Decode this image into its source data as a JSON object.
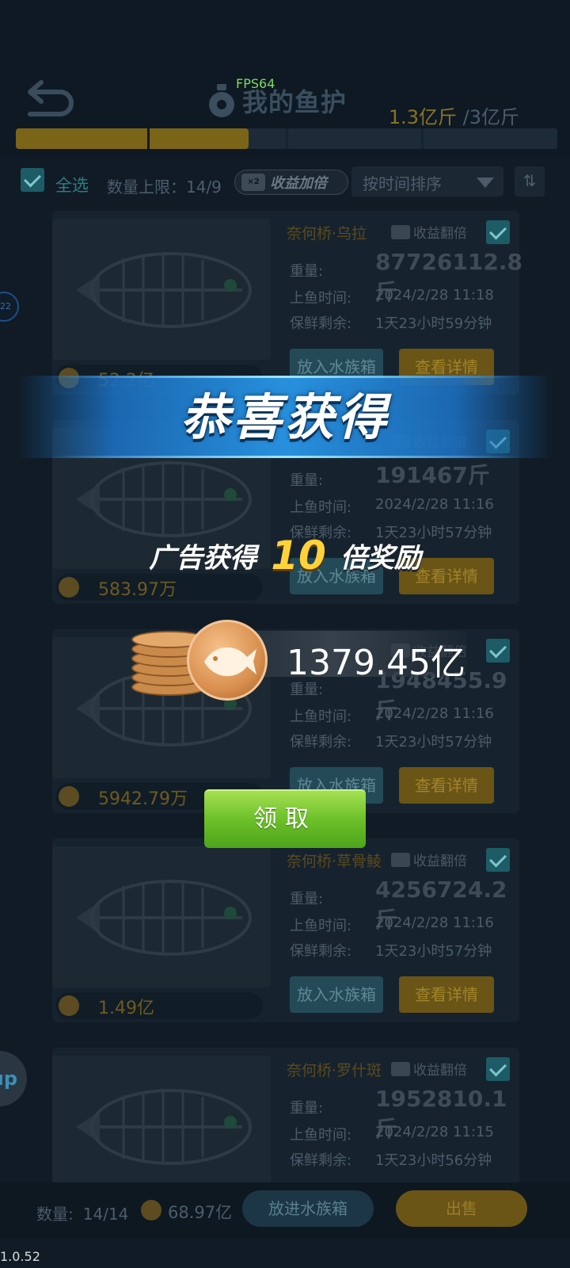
{
  "header": {
    "fps": "FPS64",
    "title": "我的鱼护",
    "capacity_current": "1.3亿斤",
    "capacity_total": "/3亿斤",
    "capacity_progress": 0.43
  },
  "toolbar": {
    "select_all": "全选",
    "quantity_limit": "数量上限：14/9",
    "boost_icon": "×2",
    "boost_label": "收益加倍",
    "sort_label": "按时间排序",
    "sort_toggle": "⇅"
  },
  "labels": {
    "weight": "重量:",
    "catch_time": "上鱼时间:",
    "freshness": "保鲜剩余:",
    "double_income": "收益翻倍",
    "to_aquarium": "放入水族箱",
    "view_details": "查看详情"
  },
  "fish_list": [
    {
      "name": "奈何桥·乌拉",
      "weight": "87726112.8斤",
      "catch_time": "2024/2/28  11:18",
      "freshness": "1天23小时59分钟",
      "price": "52.2亿"
    },
    {
      "name": "",
      "weight": "191467斤",
      "catch_time": "2024/2/28  11:16",
      "freshness": "1天23小时57分钟",
      "price": "583.97万"
    },
    {
      "name": "",
      "weight": "1948455.9斤",
      "catch_time": "2024/2/28  11:16",
      "freshness": "1天23小时57分钟",
      "price": "5942.79万"
    },
    {
      "name": "奈何桥·草骨鲮",
      "weight": "4256724.2斤",
      "catch_time": "2024/2/28  11:16",
      "freshness": "1天23小时57分钟",
      "price": "1.49亿"
    },
    {
      "name": "奈何桥·罗什斑",
      "weight": "1952810.1斤",
      "catch_time": "2024/2/28  11:15",
      "freshness": "1天23小时56分钟",
      "price": ""
    }
  ],
  "bottom": {
    "count_label": "数量:",
    "count_value": "14/14",
    "total_value": "68.97亿",
    "put_in_aquarium": "放进水族箱",
    "sell": "出售"
  },
  "side": {
    "badge": "22",
    "up": "up"
  },
  "version": "1.0.52",
  "reward": {
    "title": "恭喜获得",
    "line_prefix": "广告获得",
    "multiplier": "10",
    "line_suffix": "倍奖励",
    "amount": "1379.45亿",
    "claim_button": "领取"
  },
  "colors": {
    "accent_gold": "#ffd23a",
    "claim_green": "#6cc02a",
    "banner_blue": "#2896e6"
  }
}
